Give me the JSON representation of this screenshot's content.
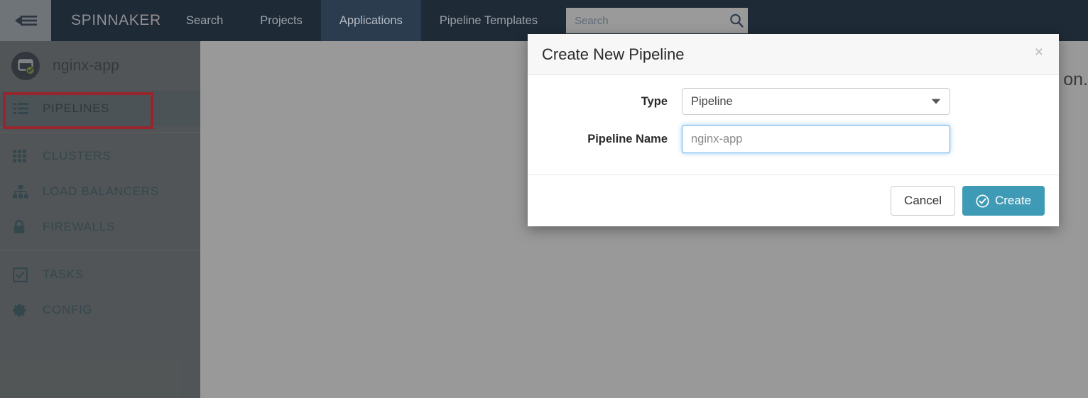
{
  "topnav": {
    "collapse_icon": "collapse-sidebar-icon",
    "brand": "SPINNAKER",
    "items": [
      {
        "label": "Search",
        "active": false
      },
      {
        "label": "Projects",
        "active": false
      },
      {
        "label": "Applications",
        "active": true
      },
      {
        "label": "Pipeline Templates",
        "active": false
      }
    ],
    "search": {
      "placeholder": "Search",
      "value": "",
      "icon": "search-icon"
    }
  },
  "sidebar": {
    "app": {
      "name": "nginx-app",
      "avatar_icon": "application-window-icon",
      "status_badge_icon": "check-circle-icon",
      "badge_color": "#8aa832",
      "avatar_color": "#273340"
    },
    "items": [
      {
        "label": "PIPELINES",
        "icon": "list-icon",
        "active": true
      },
      {
        "label": "CLUSTERS",
        "icon": "grid-icon",
        "active": false
      },
      {
        "label": "LOAD BALANCERS",
        "icon": "sitemap-icon",
        "active": false
      },
      {
        "label": "FIREWALLS",
        "icon": "lock-icon",
        "active": false
      },
      {
        "label": "TASKS",
        "icon": "check-square-icon",
        "active": false
      },
      {
        "label": "CONFIG",
        "icon": "gear-icon",
        "active": false
      }
    ],
    "annotation": {
      "color": "#fc0d1b",
      "target": "PIPELINES"
    }
  },
  "content": {
    "visible_text": "on."
  },
  "modal": {
    "title": "Create New Pipeline",
    "close_label": "×",
    "fields": [
      {
        "label": "Type",
        "kind": "select",
        "value": "Pipeline",
        "caret_icon": "chevron-down-icon"
      },
      {
        "label": "Pipeline Name",
        "kind": "text",
        "value": "",
        "placeholder": "nginx-app"
      }
    ],
    "buttons": {
      "cancel": "Cancel",
      "create": "Create",
      "create_icon": "check-circle-icon",
      "create_color": "#3f9bb5"
    }
  }
}
